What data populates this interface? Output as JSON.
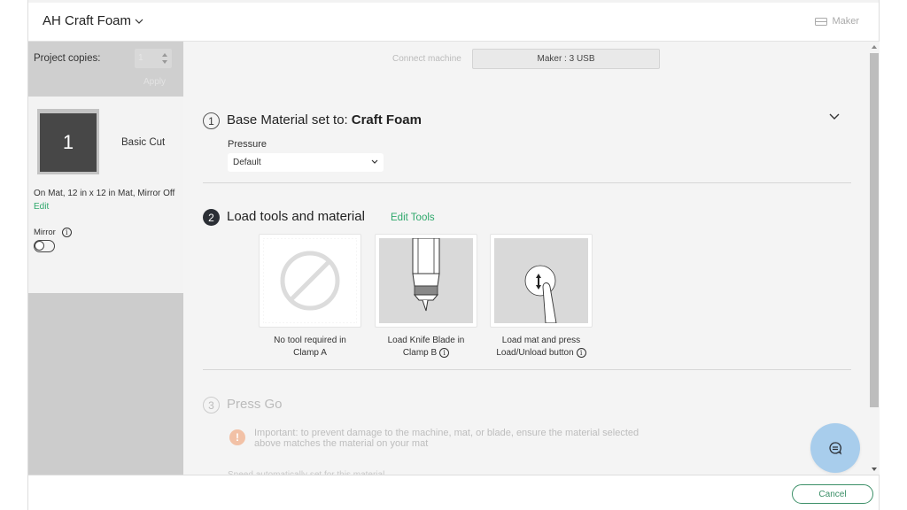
{
  "header": {
    "project_title": "AH Craft Foam",
    "title_icon": "chevron-down-icon",
    "machine_icon": "machine-icon",
    "machine_label": "Maker"
  },
  "sidebar": {
    "copies_label": "Project copies:",
    "copies_value": "1",
    "apply_label": "Apply",
    "mat": {
      "number": "1",
      "name": "Basic Cut",
      "info": "On Mat, 12 in x 12 in Mat, Mirror Off",
      "edit_label": "Edit",
      "mirror_label": "Mirror",
      "mirror_on": false
    }
  },
  "main": {
    "connect_label": "Connect machine",
    "machine_button": "Maker : 3 USB",
    "step1": {
      "number": "1",
      "title": "Base Material set to:",
      "material": "Craft Foam",
      "pressure_label": "Pressure",
      "pressure_value": "Default"
    },
    "step2": {
      "number": "2",
      "title": "Load tools and material",
      "edit_tools_label": "Edit Tools",
      "tools": [
        {
          "icon": "no-tool-icon",
          "line1": "No tool required in",
          "line2": "Clamp A",
          "info": false
        },
        {
          "icon": "knife-blade-icon",
          "line1": "Load Knife Blade in",
          "line2": "Clamp B",
          "info": true
        },
        {
          "icon": "load-unload-button-icon",
          "line1": "Load mat and press",
          "line2": "Load/Unload button",
          "info": true
        }
      ]
    },
    "step3": {
      "number": "3",
      "title": "Press Go",
      "warning": "Important: to prevent damage to the machine, mat, or blade, ensure the material selected above matches the material on your mat",
      "speed_note": "Speed automatically set for this material"
    }
  },
  "footer": {
    "cancel_label": "Cancel"
  },
  "colors": {
    "accent_green": "#2ea86b",
    "cancel_green": "#3b8f67",
    "chat_blue": "#a8cdec",
    "warning_orange": "#f2c1a6"
  }
}
